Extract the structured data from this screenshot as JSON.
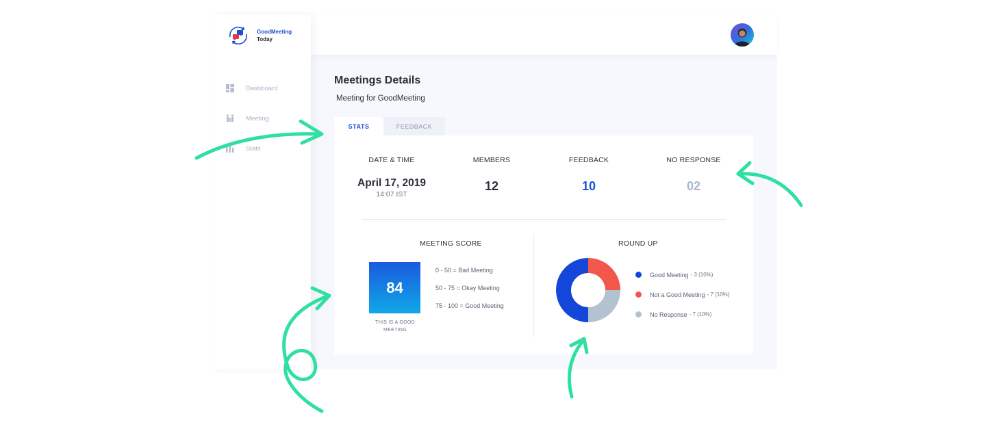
{
  "app": {
    "logo": {
      "line1": "GoodMeeting",
      "line2": "Today"
    },
    "nav": [
      {
        "label": "Dashboard",
        "icon": "dashboard-icon"
      },
      {
        "label": "Meeting",
        "icon": "meeting-icon"
      },
      {
        "label": "Stats",
        "icon": "stats-icon"
      }
    ]
  },
  "page": {
    "title": "Meetings Details",
    "subtitle": "Meeting for GoodMeeting"
  },
  "tabs": [
    {
      "label": "STATS",
      "active": true
    },
    {
      "label": "FEEDBACK",
      "active": false
    }
  ],
  "stats": {
    "date_time": {
      "label": "DATE & TIME",
      "date": "April 17, 2019",
      "time": "14:07 IST"
    },
    "members": {
      "label": "MEMBERS",
      "value": "12"
    },
    "feedback": {
      "label": "FEEDBACK",
      "value": "10"
    },
    "no_response": {
      "label": "NO RESPONSE",
      "value": "02"
    }
  },
  "meeting_score": {
    "title": "MEETING SCORE",
    "score": "84",
    "caption": "THIS IS A GOOD MEETING",
    "legend": [
      "0 - 50 = Bad Meeting",
      "50 - 75 = Okay Meeting",
      "75 - 100 = Good Meeting"
    ]
  },
  "round_up": {
    "title": "ROUND UP",
    "items": [
      {
        "label": "Good Meeting",
        "count": "- 3 (10%)",
        "color": "#1447d9",
        "share": 0.5
      },
      {
        "label": "Not a Good Meeting",
        "count": "- 7 (10%)",
        "color": "#f2574c",
        "share": 0.25
      },
      {
        "label": "No Response",
        "count": "- 7 (10%)",
        "color": "#b2c2d1",
        "share": 0.25
      }
    ]
  },
  "colors": {
    "accent": "#1a4fd6",
    "muted": "#a9b8c9",
    "annotation": "#2fe0a0"
  }
}
